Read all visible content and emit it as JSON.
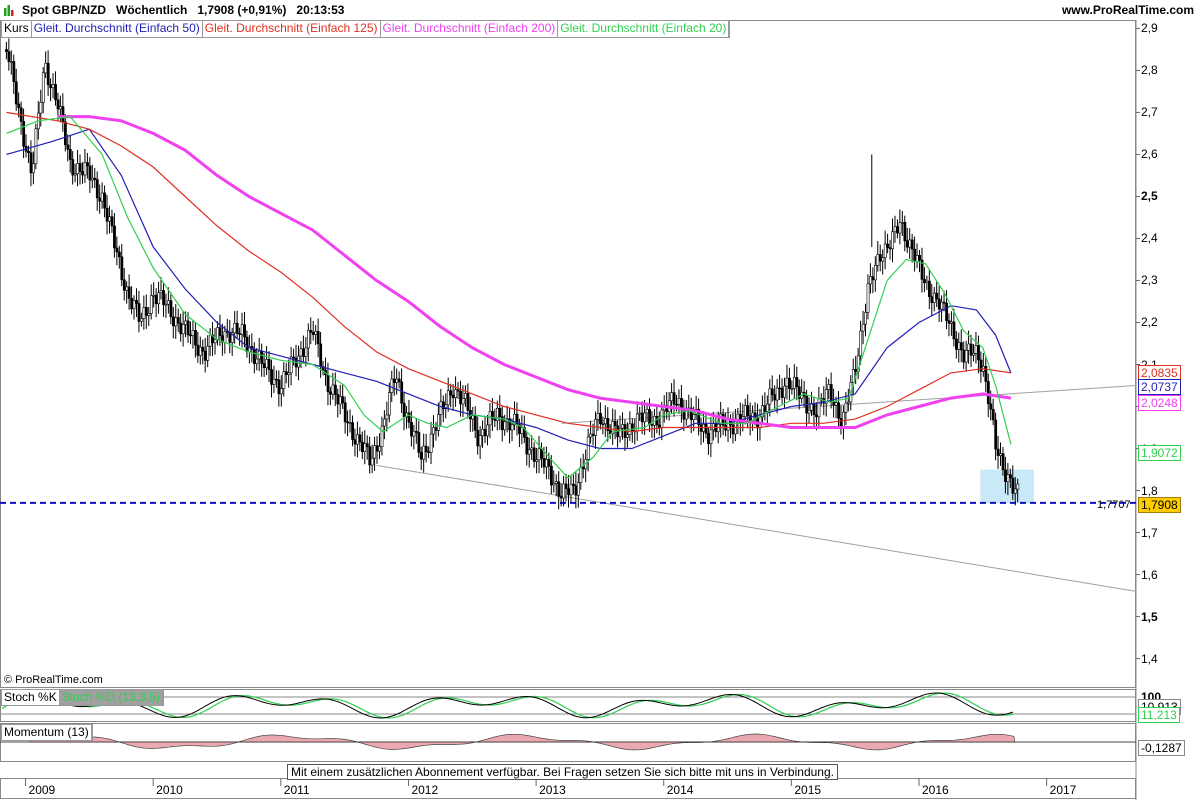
{
  "header": {
    "title": "Spot GBP/NZD   Wöchentlich   1,7908 (+0,91%)   20:13:53",
    "brand": "www.ProRealTime.com"
  },
  "legend": [
    {
      "label": "Kurs",
      "color": "#000000"
    },
    {
      "label": "Gleit. Durchschnitt (Einfach 50)",
      "color": "#1f1fb4"
    },
    {
      "label": "Gleit. Durchschnitt (Einfach 125)",
      "color": "#e03020"
    },
    {
      "label": "Gleit. Durchschnitt (Einfach 200)",
      "color": "#f040f0"
    },
    {
      "label": "Gleit. Durchschnitt (Einfach 20)",
      "color": "#30d050"
    }
  ],
  "copyright": "© ProRealTime.com",
  "stoch": {
    "label_k": "Stoch %K",
    "label_d": "Stoch %D (13,3,5)",
    "axis_top": "100",
    "val1": "10,913",
    "val2": "11,213"
  },
  "momentum": {
    "label": "Momentum (13)",
    "value": "-0,1287"
  },
  "notice": "Mit einem zusätzlichen Abonnement verfügbar. Bei Fragen setzen Sie sich bitte mit uns in Verbindung.",
  "price_tags": {
    "ma125": "2,0835",
    "ma50": "2,0737",
    "ma200": "2,0248",
    "ma20": "1,9072",
    "last": "1,7908",
    "support": "1,7707"
  },
  "chart_data": {
    "type": "line",
    "title": "Spot GBP/NZD",
    "xlabel": "",
    "ylabel": "",
    "ylim": [
      1.33,
      2.92
    ],
    "xlim": [
      2008.8,
      2017.7
    ],
    "yticks": [
      "2,9",
      "2,8",
      "2,7",
      "2,6",
      "2,5",
      "2,4",
      "2,3",
      "2,2",
      "2,1",
      "2",
      "1,9",
      "1,8",
      "1,7",
      "1,6",
      "1,5",
      "1,4"
    ],
    "bold_ticks": [
      "2,5",
      "2",
      "1,5"
    ],
    "x_tick_labels": [
      "2009",
      "2010",
      "2011",
      "2012",
      "2013",
      "2014",
      "2015",
      "2016",
      "2017"
    ],
    "price_path": [
      [
        2008.85,
        2.85
      ],
      [
        2008.95,
        2.7
      ],
      [
        2009.05,
        2.55
      ],
      [
        2009.15,
        2.82
      ],
      [
        2009.25,
        2.72
      ],
      [
        2009.35,
        2.58
      ],
      [
        2009.5,
        2.55
      ],
      [
        2009.6,
        2.5
      ],
      [
        2009.7,
        2.38
      ],
      [
        2009.8,
        2.27
      ],
      [
        2009.9,
        2.2
      ],
      [
        2010.0,
        2.27
      ],
      [
        2010.1,
        2.24
      ],
      [
        2010.25,
        2.18
      ],
      [
        2010.4,
        2.13
      ],
      [
        2010.55,
        2.18
      ],
      [
        2010.7,
        2.17
      ],
      [
        2010.85,
        2.1
      ],
      [
        2011.0,
        2.05
      ],
      [
        2011.15,
        2.13
      ],
      [
        2011.25,
        2.18
      ],
      [
        2011.35,
        2.07
      ],
      [
        2011.5,
        1.98
      ],
      [
        2011.6,
        1.92
      ],
      [
        2011.7,
        1.87
      ],
      [
        2011.8,
        1.95
      ],
      [
        2011.9,
        2.08
      ],
      [
        2012.0,
        1.96
      ],
      [
        2012.1,
        1.88
      ],
      [
        2012.25,
        1.98
      ],
      [
        2012.35,
        2.05
      ],
      [
        2012.45,
        2.0
      ],
      [
        2012.55,
        1.93
      ],
      [
        2012.7,
        1.98
      ],
      [
        2012.85,
        1.95
      ],
      [
        2013.0,
        1.88
      ],
      [
        2013.1,
        1.85
      ],
      [
        2013.2,
        1.79
      ],
      [
        2013.3,
        1.8
      ],
      [
        2013.4,
        1.9
      ],
      [
        2013.5,
        1.98
      ],
      [
        2013.65,
        1.93
      ],
      [
        2013.8,
        1.97
      ],
      [
        2013.95,
        1.97
      ],
      [
        2014.1,
        2.02
      ],
      [
        2014.2,
        1.98
      ],
      [
        2014.35,
        1.94
      ],
      [
        2014.5,
        1.96
      ],
      [
        2014.6,
        1.97
      ],
      [
        2014.75,
        1.98
      ],
      [
        2014.85,
        2.02
      ],
      [
        2014.95,
        2.06
      ],
      [
        2015.1,
        2.02
      ],
      [
        2015.2,
        1.98
      ],
      [
        2015.3,
        2.05
      ],
      [
        2015.4,
        1.95
      ],
      [
        2015.5,
        2.1
      ],
      [
        2015.6,
        2.27
      ],
      [
        2015.7,
        2.37
      ],
      [
        2015.8,
        2.4
      ],
      [
        2015.85,
        2.43
      ],
      [
        2015.95,
        2.38
      ],
      [
        2016.05,
        2.28
      ],
      [
        2016.15,
        2.26
      ],
      [
        2016.25,
        2.18
      ],
      [
        2016.35,
        2.13
      ],
      [
        2016.45,
        2.12
      ],
      [
        2016.5,
        2.1
      ],
      [
        2016.55,
        2.02
      ],
      [
        2016.6,
        1.9
      ],
      [
        2016.65,
        1.85
      ],
      [
        2016.72,
        1.83
      ],
      [
        2016.78,
        1.79
      ]
    ],
    "series": [
      {
        "name": "Gleit. Durchschnitt (Einfach 50)",
        "color": "#1f1fb4",
        "points": [
          [
            2008.85,
            2.6
          ],
          [
            2009.2,
            2.63
          ],
          [
            2009.5,
            2.66
          ],
          [
            2009.75,
            2.55
          ],
          [
            2010.0,
            2.38
          ],
          [
            2010.25,
            2.28
          ],
          [
            2010.5,
            2.2
          ],
          [
            2010.75,
            2.14
          ],
          [
            2011.0,
            2.12
          ],
          [
            2011.25,
            2.1
          ],
          [
            2011.5,
            2.08
          ],
          [
            2011.75,
            2.06
          ],
          [
            2012.0,
            2.03
          ],
          [
            2012.25,
            2.0
          ],
          [
            2012.5,
            1.98
          ],
          [
            2012.75,
            1.97
          ],
          [
            2013.0,
            1.95
          ],
          [
            2013.25,
            1.92
          ],
          [
            2013.5,
            1.9
          ],
          [
            2013.75,
            1.9
          ],
          [
            2014.0,
            1.93
          ],
          [
            2014.25,
            1.96
          ],
          [
            2014.5,
            1.96
          ],
          [
            2014.75,
            1.98
          ],
          [
            2015.0,
            2.0
          ],
          [
            2015.25,
            2.01
          ],
          [
            2015.5,
            2.03
          ],
          [
            2015.75,
            2.14
          ],
          [
            2016.0,
            2.2
          ],
          [
            2016.25,
            2.24
          ],
          [
            2016.45,
            2.23
          ],
          [
            2016.6,
            2.17
          ],
          [
            2016.72,
            2.08
          ]
        ]
      },
      {
        "name": "Gleit. Durchschnitt (Einfach 125)",
        "color": "#e03020",
        "points": [
          [
            2008.85,
            2.7
          ],
          [
            2009.25,
            2.68
          ],
          [
            2009.5,
            2.66
          ],
          [
            2009.75,
            2.62
          ],
          [
            2010.0,
            2.57
          ],
          [
            2010.25,
            2.5
          ],
          [
            2010.5,
            2.43
          ],
          [
            2010.75,
            2.37
          ],
          [
            2011.0,
            2.32
          ],
          [
            2011.25,
            2.26
          ],
          [
            2011.5,
            2.19
          ],
          [
            2011.75,
            2.13
          ],
          [
            2012.0,
            2.09
          ],
          [
            2012.25,
            2.06
          ],
          [
            2012.5,
            2.03
          ],
          [
            2012.75,
            2.0
          ],
          [
            2013.0,
            1.98
          ],
          [
            2013.25,
            1.96
          ],
          [
            2013.5,
            1.95
          ],
          [
            2013.75,
            1.94
          ],
          [
            2014.0,
            1.95
          ],
          [
            2014.25,
            1.95
          ],
          [
            2014.5,
            1.95
          ],
          [
            2014.75,
            1.95
          ],
          [
            2015.0,
            1.96
          ],
          [
            2015.25,
            1.96
          ],
          [
            2015.5,
            1.97
          ],
          [
            2015.75,
            2.0
          ],
          [
            2016.0,
            2.04
          ],
          [
            2016.25,
            2.08
          ],
          [
            2016.5,
            2.09
          ],
          [
            2016.72,
            2.08
          ]
        ]
      },
      {
        "name": "Gleit. Durchschnitt (Einfach 200)",
        "color": "#f040f0",
        "points": [
          [
            2009.25,
            2.69
          ],
          [
            2009.5,
            2.69
          ],
          [
            2009.75,
            2.68
          ],
          [
            2010.0,
            2.65
          ],
          [
            2010.25,
            2.61
          ],
          [
            2010.5,
            2.55
          ],
          [
            2010.75,
            2.5
          ],
          [
            2011.0,
            2.46
          ],
          [
            2011.25,
            2.42
          ],
          [
            2011.5,
            2.36
          ],
          [
            2011.75,
            2.3
          ],
          [
            2012.0,
            2.25
          ],
          [
            2012.25,
            2.19
          ],
          [
            2012.5,
            2.14
          ],
          [
            2012.75,
            2.1
          ],
          [
            2013.0,
            2.07
          ],
          [
            2013.25,
            2.04
          ],
          [
            2013.5,
            2.02
          ],
          [
            2013.75,
            2.01
          ],
          [
            2014.0,
            2.0
          ],
          [
            2014.25,
            1.99
          ],
          [
            2014.5,
            1.97
          ],
          [
            2014.75,
            1.96
          ],
          [
            2015.0,
            1.95
          ],
          [
            2015.25,
            1.95
          ],
          [
            2015.5,
            1.95
          ],
          [
            2015.75,
            1.98
          ],
          [
            2016.0,
            2.0
          ],
          [
            2016.25,
            2.02
          ],
          [
            2016.5,
            2.03
          ],
          [
            2016.72,
            2.02
          ]
        ]
      },
      {
        "name": "Gleit. Durchschnitt (Einfach 20)",
        "color": "#30d050",
        "points": [
          [
            2008.85,
            2.65
          ],
          [
            2009.1,
            2.68
          ],
          [
            2009.35,
            2.69
          ],
          [
            2009.6,
            2.6
          ],
          [
            2009.8,
            2.45
          ],
          [
            2010.0,
            2.33
          ],
          [
            2010.25,
            2.22
          ],
          [
            2010.5,
            2.16
          ],
          [
            2010.75,
            2.13
          ],
          [
            2011.0,
            2.11
          ],
          [
            2011.25,
            2.1
          ],
          [
            2011.5,
            2.05
          ],
          [
            2011.65,
            1.98
          ],
          [
            2011.8,
            1.94
          ],
          [
            2012.0,
            1.98
          ],
          [
            2012.15,
            1.96
          ],
          [
            2012.3,
            1.95
          ],
          [
            2012.5,
            1.98
          ],
          [
            2012.75,
            1.97
          ],
          [
            2012.9,
            1.95
          ],
          [
            2013.1,
            1.88
          ],
          [
            2013.25,
            1.83
          ],
          [
            2013.45,
            1.88
          ],
          [
            2013.6,
            1.94
          ],
          [
            2013.85,
            1.95
          ],
          [
            2014.0,
            1.98
          ],
          [
            2014.2,
            1.99
          ],
          [
            2014.45,
            1.96
          ],
          [
            2014.65,
            1.96
          ],
          [
            2014.9,
            2.0
          ],
          [
            2015.1,
            2.03
          ],
          [
            2015.3,
            2.01
          ],
          [
            2015.45,
            2.02
          ],
          [
            2015.6,
            2.16
          ],
          [
            2015.75,
            2.3
          ],
          [
            2015.9,
            2.35
          ],
          [
            2016.05,
            2.34
          ],
          [
            2016.2,
            2.27
          ],
          [
            2016.35,
            2.18
          ],
          [
            2016.5,
            2.14
          ],
          [
            2016.6,
            2.05
          ],
          [
            2016.72,
            1.91
          ]
        ]
      }
    ],
    "support_level": 1.7707,
    "upper_trendline": [
      [
        2013.2,
        1.96
      ],
      [
        2017.7,
        2.05
      ]
    ],
    "lower_trendline": [
      [
        2011.75,
        1.86
      ],
      [
        2017.7,
        1.56
      ]
    ],
    "highlight_zone": {
      "x": [
        2016.48,
        2016.9
      ],
      "y": [
        1.77,
        1.85
      ]
    }
  }
}
